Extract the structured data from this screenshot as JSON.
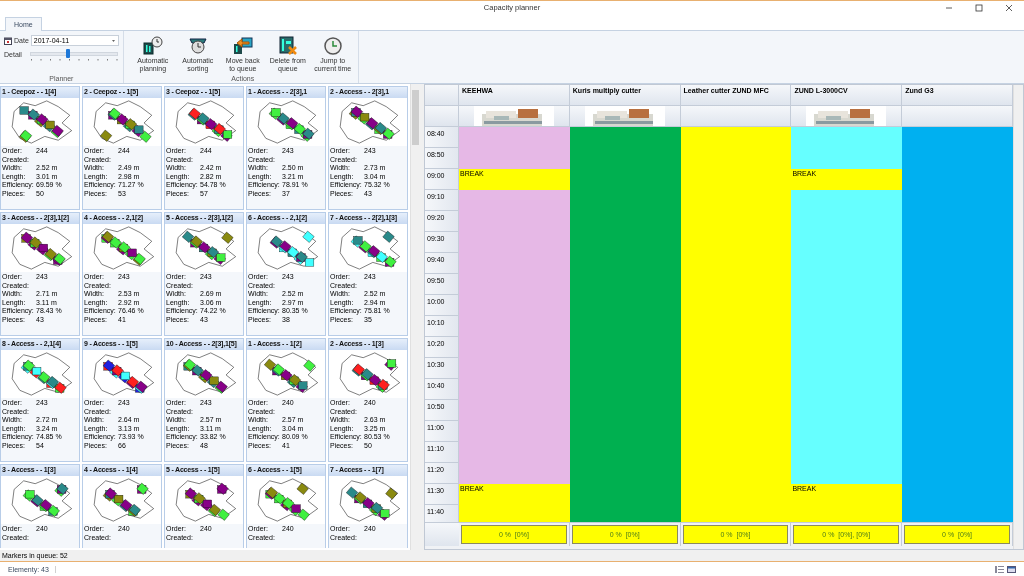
{
  "window": {
    "title": "Capacity planner"
  },
  "tabs": [
    {
      "label": "Home",
      "selected": true
    }
  ],
  "planner": {
    "date_label": "Date",
    "date": "2017-04-11",
    "detail_label": "Detail",
    "detail": {
      "level": 0.43
    },
    "group_label": "Planner"
  },
  "actions": {
    "group_label": "Actions",
    "buttons": [
      {
        "kind": "planning",
        "label": "Automatic planning"
      },
      {
        "kind": "sorting",
        "label": "Automatic sorting"
      },
      {
        "kind": "back",
        "label": "Move back to queue"
      },
      {
        "kind": "delete",
        "label": "Delete from queue"
      },
      {
        "kind": "jump",
        "label": "Jump to current time"
      }
    ]
  },
  "markers": [
    {
      "title": "1 - Ceepoz - - 1[4]",
      "fields": [
        {
          "label": "Order:",
          "value": "244"
        },
        {
          "label": "Created:"
        },
        {
          "label": "Width:",
          "value": "2.52 m"
        },
        {
          "label": "Length:",
          "value": "3.01 m"
        },
        {
          "label": "Efficiency:",
          "value": "69.59 %"
        },
        {
          "label": "Pieces:",
          "value": "50"
        }
      ]
    },
    {
      "title": "2 - Ceepoz - - 1[5]",
      "fields": [
        {
          "label": "Order:",
          "value": "244"
        },
        {
          "label": "Created:"
        },
        {
          "label": "Width:",
          "value": "2.49 m"
        },
        {
          "label": "Length:",
          "value": "2.98 m"
        },
        {
          "label": "Efficiency:",
          "value": "71.27 %"
        },
        {
          "label": "Pieces:",
          "value": "53"
        }
      ]
    },
    {
      "title": "3 - Ceepoz - - 1[5]",
      "fields": [
        {
          "label": "Order:",
          "value": "244"
        },
        {
          "label": "Created:"
        },
        {
          "label": "Width:",
          "value": "2.42 m"
        },
        {
          "label": "Length:",
          "value": "2.82 m"
        },
        {
          "label": "Efficiency:",
          "value": "54.78 %"
        },
        {
          "label": "Pieces:",
          "value": "57"
        }
      ]
    },
    {
      "title": "1 - Access - - 2[3],1",
      "fields": [
        {
          "label": "Order:",
          "value": "243"
        },
        {
          "label": "Created:"
        },
        {
          "label": "Width:",
          "value": "2.50 m"
        },
        {
          "label": "Length:",
          "value": "3.21 m"
        },
        {
          "label": "Efficiency:",
          "value": "78.91 %"
        },
        {
          "label": "Pieces:",
          "value": "37"
        }
      ]
    },
    {
      "title": "2 - Access - - 2[3],1",
      "fields": [
        {
          "label": "Order:",
          "value": "243"
        },
        {
          "label": "Created:"
        },
        {
          "label": "Width:",
          "value": "2.73 m"
        },
        {
          "label": "Length:",
          "value": "3.04 m"
        },
        {
          "label": "Efficiency:",
          "value": "75.32 %"
        },
        {
          "label": "Pieces:",
          "value": "43"
        }
      ]
    },
    {
      "title": "3 - Access - - 2[3],1[2]",
      "fields": [
        {
          "label": "Order:",
          "value": "243"
        },
        {
          "label": "Created:"
        },
        {
          "label": "Width:",
          "value": "2.71 m"
        },
        {
          "label": "Length:",
          "value": "3.11 m"
        },
        {
          "label": "Efficiency:",
          "value": "78.43 %"
        },
        {
          "label": "Pieces:",
          "value": "43"
        }
      ]
    },
    {
      "title": "4 - Access - - 2,1[2]",
      "fields": [
        {
          "label": "Order:",
          "value": "243"
        },
        {
          "label": "Created:"
        },
        {
          "label": "Width:",
          "value": "2.53 m"
        },
        {
          "label": "Length:",
          "value": "2.92 m"
        },
        {
          "label": "Efficiency:",
          "value": "76.46 %"
        },
        {
          "label": "Pieces:",
          "value": "41"
        }
      ]
    },
    {
      "title": "5 - Access - - 2[3],1[2]",
      "fields": [
        {
          "label": "Order:",
          "value": "243"
        },
        {
          "label": "Created:"
        },
        {
          "label": "Width:",
          "value": "2.69 m"
        },
        {
          "label": "Length:",
          "value": "3.06 m"
        },
        {
          "label": "Efficiency:",
          "value": "74.22 %"
        },
        {
          "label": "Pieces:",
          "value": "43"
        }
      ]
    },
    {
      "title": "6 - Access - - 2,1[2]",
      "fields": [
        {
          "label": "Order:",
          "value": "243"
        },
        {
          "label": "Created:"
        },
        {
          "label": "Width:",
          "value": "2.52 m"
        },
        {
          "label": "Length:",
          "value": "2.97 m"
        },
        {
          "label": "Efficiency:",
          "value": "80.35 %"
        },
        {
          "label": "Pieces:",
          "value": "38"
        }
      ]
    },
    {
      "title": "7 - Access - - 2[2],1[3]",
      "fields": [
        {
          "label": "Order:",
          "value": "243"
        },
        {
          "label": "Created:"
        },
        {
          "label": "Width:",
          "value": "2.52 m"
        },
        {
          "label": "Length:",
          "value": "2.94 m"
        },
        {
          "label": "Efficiency:",
          "value": "75.81 %"
        },
        {
          "label": "Pieces:",
          "value": "35"
        }
      ]
    },
    {
      "title": "8 - Access - - 2,1[4]",
      "fields": [
        {
          "label": "Order:",
          "value": "243"
        },
        {
          "label": "Created:"
        },
        {
          "label": "Width:",
          "value": "2.72 m"
        },
        {
          "label": "Length:",
          "value": "3.24 m"
        },
        {
          "label": "Efficiency:",
          "value": "74.85 %"
        },
        {
          "label": "Pieces:",
          "value": "54"
        }
      ]
    },
    {
      "title": "9 - Access - - 1[5]",
      "fields": [
        {
          "label": "Order:",
          "value": "243"
        },
        {
          "label": "Created:"
        },
        {
          "label": "Width:",
          "value": "2.64 m"
        },
        {
          "label": "Length:",
          "value": "3.13 m"
        },
        {
          "label": "Efficiency:",
          "value": "73.93 %"
        },
        {
          "label": "Pieces:",
          "value": "66"
        }
      ]
    },
    {
      "title": "10 - Access - - 2[3],1[5]",
      "fields": [
        {
          "label": "Order:",
          "value": "243"
        },
        {
          "label": "Created:"
        },
        {
          "label": "Width:",
          "value": "2.57 m"
        },
        {
          "label": "Length:",
          "value": "3.11 m"
        },
        {
          "label": "Efficiency:",
          "value": "33.82 %"
        },
        {
          "label": "Pieces:",
          "value": "48"
        }
      ]
    },
    {
      "title": "1 - Access - - 1[2]",
      "fields": [
        {
          "label": "Order:",
          "value": "240"
        },
        {
          "label": "Created:"
        },
        {
          "label": "Width:",
          "value": "2.57 m"
        },
        {
          "label": "Length:",
          "value": "3.04 m"
        },
        {
          "label": "Efficiency:",
          "value": "80.09 %"
        },
        {
          "label": "Pieces:",
          "value": "41"
        }
      ]
    },
    {
      "title": "2 - Access - - 1[3]",
      "fields": [
        {
          "label": "Order:",
          "value": "240"
        },
        {
          "label": "Created:"
        },
        {
          "label": "Width:",
          "value": "2.63 m"
        },
        {
          "label": "Length:",
          "value": "3.25 m"
        },
        {
          "label": "Efficiency:",
          "value": "80.53 %"
        },
        {
          "label": "Pieces:",
          "value": "50"
        }
      ]
    },
    {
      "title": "3 - Access - - 1[3]",
      "fields": [
        {
          "label": "Order:",
          "value": "240"
        },
        {
          "label": "Created:"
        }
      ]
    },
    {
      "title": "4 - Access - - 1[4]",
      "fields": [
        {
          "label": "Order:",
          "value": "240"
        },
        {
          "label": "Created:"
        }
      ]
    },
    {
      "title": "5 - Access - - 1[5]",
      "fields": [
        {
          "label": "Order:",
          "value": "240"
        },
        {
          "label": "Created:"
        }
      ]
    },
    {
      "title": "6 - Access - - 1[5]",
      "fields": [
        {
          "label": "Order:",
          "value": "240"
        },
        {
          "label": "Created:"
        }
      ]
    },
    {
      "title": "7 - Access - - 1[7]",
      "fields": [
        {
          "label": "Order:",
          "value": "240"
        },
        {
          "label": "Created:"
        }
      ]
    }
  ],
  "queue_status": "Markers in queue: 52",
  "schedule": {
    "machines": [
      {
        "name": "KEEHWA",
        "footer": "0 %  [0%]"
      },
      {
        "name": "Kuris multiply cutter",
        "footer": "0 %  [0%]"
      },
      {
        "name": "Leather cutter ZUND MFC",
        "footer": "0 %  [0%]"
      },
      {
        "name": "ZUND L-3000CV",
        "footer": "0 %  [0%], [0%]"
      },
      {
        "name": "Zund G3",
        "footer": "0 %  [0%]"
      }
    ],
    "rows": [
      {
        "time": "08:40",
        "cells": [
          {
            "color": "#e6b8e6"
          },
          {
            "color": "#00b050"
          },
          {
            "color": "#ffff00"
          },
          {
            "color": "#66ffff"
          },
          {
            "color": "#00b0f0"
          }
        ]
      },
      {
        "time": "08:50",
        "cells": [
          {
            "color": "#e6b8e6"
          },
          {
            "color": "#00b050"
          },
          {
            "color": "#ffff00"
          },
          {
            "color": "#66ffff"
          },
          {
            "color": "#00b0f0"
          }
        ]
      },
      {
        "time": "09:00",
        "cells": [
          {
            "color": "#ffff00",
            "label": "BREAK"
          },
          {
            "color": "#00b050"
          },
          {
            "color": "#ffff00"
          },
          {
            "color": "#ffff00",
            "label": "BREAK"
          },
          {
            "color": "#00b0f0"
          }
        ]
      },
      {
        "time": "09:10",
        "cells": [
          {
            "color": "#e6b8e6"
          },
          {
            "color": "#00b050"
          },
          {
            "color": "#ffff00"
          },
          {
            "color": "#66ffff"
          },
          {
            "color": "#00b0f0"
          }
        ]
      },
      {
        "time": "09:20",
        "cells": [
          {
            "color": "#e6b8e6"
          },
          {
            "color": "#00b050"
          },
          {
            "color": "#ffff00"
          },
          {
            "color": "#66ffff"
          },
          {
            "color": "#00b0f0"
          }
        ]
      },
      {
        "time": "09:30",
        "cells": [
          {
            "color": "#e6b8e6"
          },
          {
            "color": "#00b050"
          },
          {
            "color": "#ffff00"
          },
          {
            "color": "#66ffff"
          },
          {
            "color": "#00b0f0"
          }
        ]
      },
      {
        "time": "09:40",
        "cells": [
          {
            "color": "#e6b8e6"
          },
          {
            "color": "#00b050"
          },
          {
            "color": "#ffff00"
          },
          {
            "color": "#66ffff"
          },
          {
            "color": "#00b0f0"
          }
        ]
      },
      {
        "time": "09:50",
        "cells": [
          {
            "color": "#e6b8e6"
          },
          {
            "color": "#00b050"
          },
          {
            "color": "#ffff00"
          },
          {
            "color": "#66ffff"
          },
          {
            "color": "#00b0f0"
          }
        ]
      },
      {
        "time": "10:00",
        "cells": [
          {
            "color": "#e6b8e6"
          },
          {
            "color": "#00b050"
          },
          {
            "color": "#ffff00"
          },
          {
            "color": "#66ffff"
          },
          {
            "color": "#00b0f0"
          }
        ]
      },
      {
        "time": "10:10",
        "cells": [
          {
            "color": "#e6b8e6"
          },
          {
            "color": "#00b050"
          },
          {
            "color": "#ffff00"
          },
          {
            "color": "#66ffff"
          },
          {
            "color": "#00b0f0"
          }
        ]
      },
      {
        "time": "10:20",
        "cells": [
          {
            "color": "#e6b8e6"
          },
          {
            "color": "#00b050"
          },
          {
            "color": "#ffff00"
          },
          {
            "color": "#66ffff"
          },
          {
            "color": "#00b0f0"
          }
        ]
      },
      {
        "time": "10:30",
        "cells": [
          {
            "color": "#e6b8e6"
          },
          {
            "color": "#00b050"
          },
          {
            "color": "#ffff00"
          },
          {
            "color": "#66ffff"
          },
          {
            "color": "#00b0f0"
          }
        ]
      },
      {
        "time": "10:40",
        "cells": [
          {
            "color": "#e6b8e6"
          },
          {
            "color": "#00b050"
          },
          {
            "color": "#ffff00"
          },
          {
            "color": "#66ffff"
          },
          {
            "color": "#00b0f0"
          }
        ]
      },
      {
        "time": "10:50",
        "cells": [
          {
            "color": "#e6b8e6"
          },
          {
            "color": "#00b050"
          },
          {
            "color": "#ffff00"
          },
          {
            "color": "#66ffff"
          },
          {
            "color": "#00b0f0"
          }
        ]
      },
      {
        "time": "11:00",
        "cells": [
          {
            "color": "#e6b8e6"
          },
          {
            "color": "#00b050"
          },
          {
            "color": "#ffff00"
          },
          {
            "color": "#66ffff"
          },
          {
            "color": "#00b0f0"
          }
        ]
      },
      {
        "time": "11:10",
        "cells": [
          {
            "color": "#e6b8e6"
          },
          {
            "color": "#00b050"
          },
          {
            "color": "#ffff00"
          },
          {
            "color": "#66ffff"
          },
          {
            "color": "#00b0f0"
          }
        ]
      },
      {
        "time": "11:20",
        "cells": [
          {
            "color": "#e6b8e6"
          },
          {
            "color": "#00b050"
          },
          {
            "color": "#ffff00"
          },
          {
            "color": "#66ffff"
          },
          {
            "color": "#00b0f0"
          }
        ]
      },
      {
        "time": "11:30",
        "cells": [
          {
            "color": "#ffff00",
            "label": "BREAK"
          },
          {
            "color": "#00b050"
          },
          {
            "color": "#ffff00"
          },
          {
            "color": "#ffff00",
            "label": "BREAK"
          },
          {
            "color": "#00b0f0"
          }
        ]
      },
      {
        "time": "11:40",
        "cells": [
          {
            "color": "#ffff00"
          },
          {
            "color": "#00b050"
          },
          {
            "color": "#ffff00"
          },
          {
            "color": "#ffff00"
          },
          {
            "color": "#00b0f0"
          }
        ]
      }
    ]
  },
  "status_bar": {
    "text": "Elementy: 43"
  }
}
